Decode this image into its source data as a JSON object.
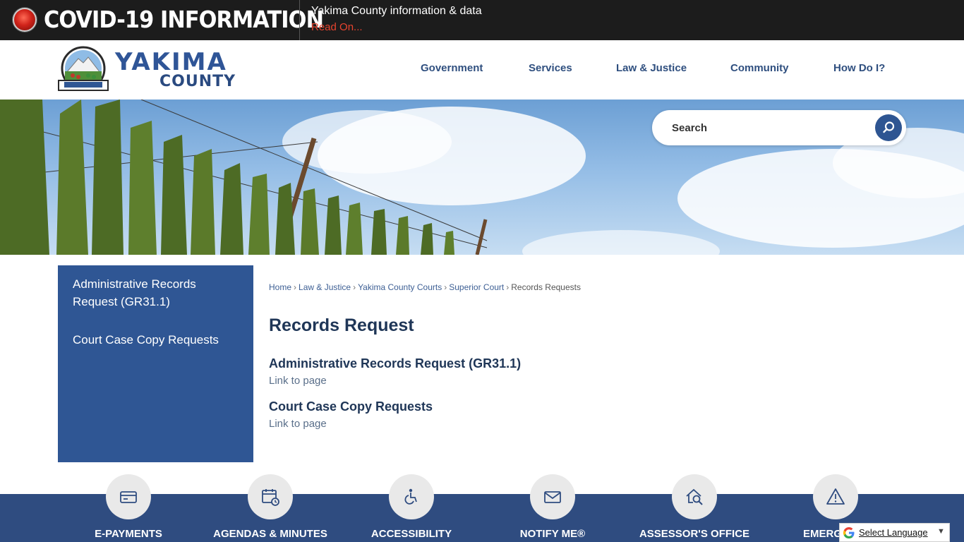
{
  "alert": {
    "title": "COVID-19 INFORMATION",
    "text": "Yakima County information & data",
    "link": "Read On..."
  },
  "header": {
    "logo_word": "YAKIMA",
    "logo_sub": "COUNTY",
    "nav": [
      "Government",
      "Services",
      "Law & Justice",
      "Community",
      "How Do I?"
    ]
  },
  "search": {
    "placeholder": "Search"
  },
  "sidebar": {
    "items": [
      {
        "label": "Administrative Records Request (GR31.1)"
      },
      {
        "label": "Court Case Copy Requests"
      }
    ]
  },
  "breadcrumb": {
    "items": [
      "Home",
      "Law & Justice",
      "Yakima County Courts",
      "Superior Court"
    ],
    "current": "Records Requests",
    "separator": "›"
  },
  "main": {
    "title": "Records Request",
    "entries": [
      {
        "title": "Administrative Records Request (GR31.1)",
        "link": "Link to page"
      },
      {
        "title": "Court Case Copy Requests",
        "link": "Link to page"
      }
    ]
  },
  "quick_links": [
    {
      "label": "E-PAYMENTS",
      "icon": "credit-card-icon"
    },
    {
      "label": "AGENDAS & MINUTES",
      "icon": "calendar-clock-icon"
    },
    {
      "label": "ACCESSIBILITY",
      "icon": "wheelchair-icon"
    },
    {
      "label": "NOTIFY ME®",
      "icon": "envelope-icon"
    },
    {
      "label": "ASSESSOR'S OFFICE",
      "icon": "house-search-icon"
    },
    {
      "label": "EMERGENCY",
      "icon": "warning-icon"
    }
  ],
  "translate": {
    "label": "Select Language",
    "arrow": "▼"
  },
  "colors": {
    "brand_blue": "#2f5694",
    "alert_red": "#e8442f",
    "footer_blue": "#2f4c80"
  }
}
